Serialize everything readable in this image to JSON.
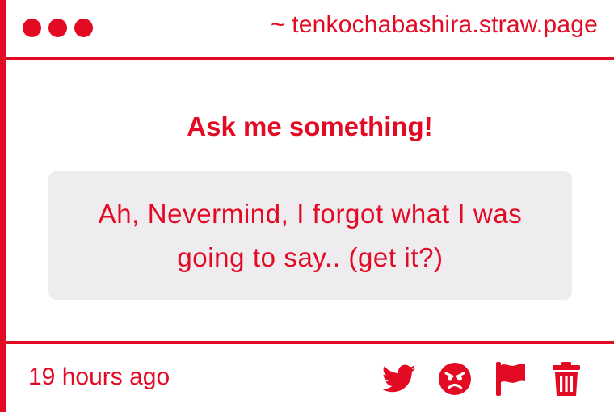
{
  "window": {
    "url": "~ tenkochabashira.straw.page"
  },
  "main": {
    "heading": "Ask me something!",
    "question": "Ah, Nevermind, I forgot what I was going to say.. (get it?)"
  },
  "footer": {
    "timestamp": "19 hours ago",
    "actions": [
      {
        "icon": "twitter-icon"
      },
      {
        "icon": "angry-face-icon"
      },
      {
        "icon": "flag-icon"
      },
      {
        "icon": "trash-icon"
      }
    ]
  },
  "colors": {
    "accent": "#e30a24",
    "question_bg": "#eeecee",
    "background": "#ffffff"
  }
}
